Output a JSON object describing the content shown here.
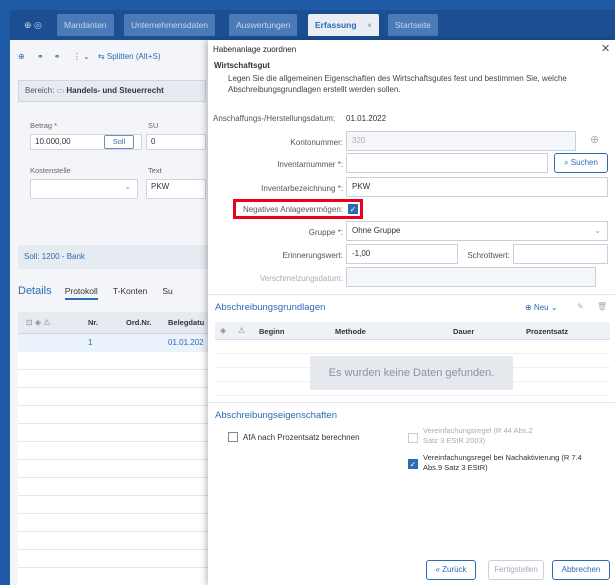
{
  "tabs": [
    {
      "label": "Mandanten"
    },
    {
      "label": "Unternehmensdaten"
    },
    {
      "label": "Auswertungen"
    },
    {
      "label": "Erfassung",
      "close": "×"
    },
    {
      "label": "Startseite"
    }
  ],
  "toolbar": {
    "split_label": "Splitten (Alt+S)"
  },
  "bereich": {
    "label": "Bereich:",
    "value": "Handels- und Steuerrecht"
  },
  "booking": {
    "betrag_label": "Betrag *",
    "betrag_value": "10.000,00",
    "soll_button": "Soll",
    "su_label": "SU",
    "su_value": "0",
    "kostenstelle_label": "Kostenstelle",
    "text_label": "Text",
    "text_value": "PKW",
    "soll_line": "Soll: 1200 - Bank"
  },
  "details": {
    "title": "Details",
    "tabs": [
      "Protokoll",
      "T-Konten",
      "Su"
    ],
    "columns": [
      "Nr.",
      "Ord.Nr.",
      "Belegdatu"
    ],
    "row": {
      "nr": "1",
      "date": "01.01.202"
    }
  },
  "dialog": {
    "title": "Habenanlage zuordnen",
    "section1": "Wirtschaftsgut",
    "description": "Legen Sie die allgemeinen Eigenschaften des Wirtschaftsgutes fest und bestimmen Sie, welche Abschreibungsgrundlagen erstellt werden sollen.",
    "acq_date_label": "Anschaffungs-/Herstellungsdatum:",
    "acq_date_value": "01.01.2022",
    "kontonummer_label": "Kontonummer:",
    "kontonummer_value": "320",
    "inventarnummer_label": "Inventarnummer *:",
    "inventarnummer_value": "",
    "suchen_label": "Suchen",
    "inventarbezeichnung_label": "Inventarbezeichnung *:",
    "inventarbezeichnung_value": "PKW",
    "negativ_label": "Negatives Anlagevermögen:",
    "gruppe_label": "Gruppe *:",
    "gruppe_value": "Ohne Gruppe",
    "erinnerungswert_label": "Erinnerungswert:",
    "erinnerungswert_value": "-1,00",
    "schrottwert_label": "Schrottwert:",
    "schrottwert_value": "",
    "verschmelzung_label": "Verschmelzungsdatum:",
    "abschreibung_title": "Abschreibungsgrundlagen",
    "neu_label": "Neu",
    "columns": [
      "Beginn",
      "Methode",
      "Dauer",
      "Prozentsatz"
    ],
    "empty_text": "Es wurden keine Daten gefunden.",
    "eigenschaften_title": "Abschreibungseigenschaften",
    "afa_label": "AfA nach Prozentsatz berechnen",
    "vereinfachung1": "Vereinfachungsregel (R 44 Abs.2 Satz 3 EStR 2003)",
    "vereinfachung2": "Vereinfachungsregel bei Nachaktivierung (R 7.4 Abs.9 Satz 3 EStR)",
    "back_button": "« Zurück",
    "finish_button": "Fertigstellen",
    "cancel_button": "Abbrechen"
  },
  "colors": {
    "accent": "#2b6cb5",
    "highlight": "#e8001c"
  }
}
